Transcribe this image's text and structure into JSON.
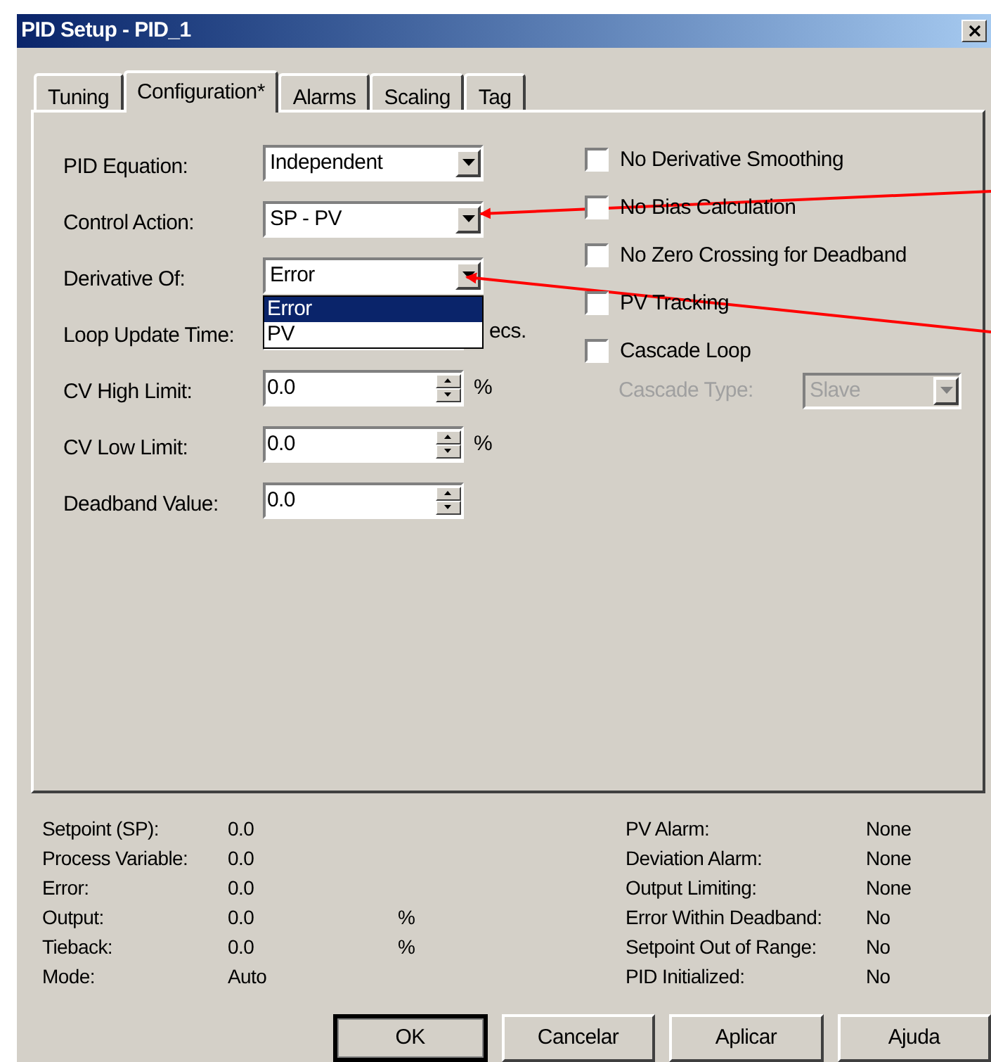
{
  "window": {
    "title": "PID Setup - PID_1"
  },
  "tabs": [
    {
      "label": "Tuning",
      "selected": false
    },
    {
      "label": "Configuration*",
      "selected": true
    },
    {
      "label": "Alarms",
      "selected": false
    },
    {
      "label": "Scaling",
      "selected": false
    },
    {
      "label": "Tag",
      "selected": false
    }
  ],
  "fields": [
    {
      "kind": "dropdown",
      "label": "PID Equation:",
      "value": "Independent"
    },
    {
      "kind": "dropdown",
      "label": "Control Action:",
      "value": "SP - PV"
    },
    {
      "kind": "dropdown",
      "label": "Derivative Of:",
      "value": "Error",
      "expanded": true,
      "options": [
        {
          "label": "Error",
          "selected": true
        },
        {
          "label": "PV",
          "selected": false
        }
      ]
    },
    {
      "kind": "spin",
      "label": "Loop Update Time:",
      "unit": "ecs."
    },
    {
      "kind": "spin",
      "label": "CV High Limit:",
      "value": "0.0",
      "unit": "%"
    },
    {
      "kind": "spin",
      "label": "CV Low Limit:",
      "value": "0.0",
      "unit": "%"
    },
    {
      "kind": "spin",
      "label": "Deadband Value:",
      "value": "0.0"
    }
  ],
  "checkboxes": [
    {
      "label": "No Derivative Smoothing",
      "checked": false
    },
    {
      "label": "No Bias Calculation",
      "checked": false
    },
    {
      "label": "No Zero Crossing for Deadband",
      "checked": false
    },
    {
      "label": "PV Tracking",
      "checked": false
    },
    {
      "label": "Cascade Loop",
      "checked": false
    }
  ],
  "cascade_type": {
    "label": "Cascade Type:",
    "value": "Slave",
    "disabled": true
  },
  "status_left": [
    {
      "label": "Setpoint (SP):",
      "value": "0.0"
    },
    {
      "label": "Process Variable:",
      "value": "0.0"
    },
    {
      "label": "Error:",
      "value": "0.0"
    },
    {
      "label": "Output:",
      "value": "0.0",
      "unit": "%"
    },
    {
      "label": "Tieback:",
      "value": "0.0",
      "unit": "%"
    },
    {
      "label": "Mode:",
      "value": "Auto"
    }
  ],
  "status_right": [
    {
      "label": "PV Alarm:",
      "value": "None"
    },
    {
      "label": "Deviation Alarm:",
      "value": "None"
    },
    {
      "label": "Output Limiting:",
      "value": "None"
    },
    {
      "label": "Error Within Deadband:",
      "value": "No"
    },
    {
      "label": "Setpoint Out of Range:",
      "value": "No"
    },
    {
      "label": "PID Initialized:",
      "value": "No"
    }
  ],
  "buttons": [
    {
      "label": "OK",
      "default": true
    },
    {
      "label": "Cancelar",
      "default": false
    },
    {
      "label": "Aplicar",
      "default": false
    },
    {
      "label": "Ajuda",
      "default": false
    }
  ]
}
